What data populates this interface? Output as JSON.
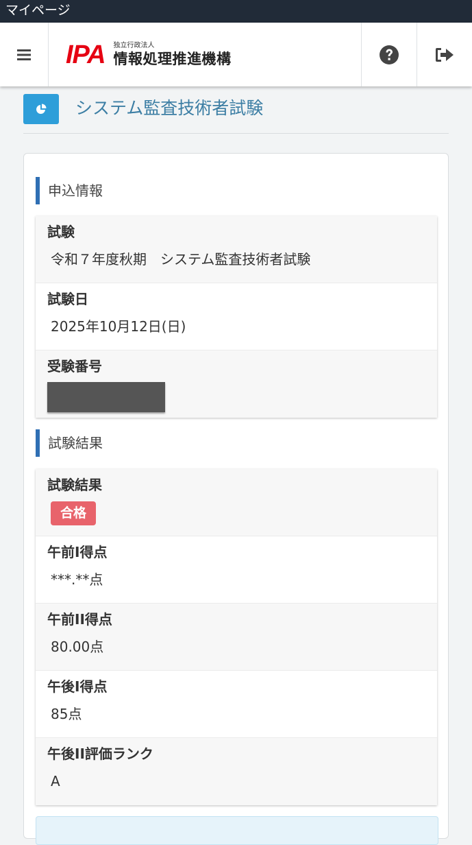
{
  "window": {
    "title": "マイページ"
  },
  "navbar": {
    "logo_text": "IPA",
    "org_sub": "独立行政法人",
    "org_name": "情報処理推進機構",
    "icons": [
      "menu-icon",
      "help-icon",
      "logout-icon"
    ]
  },
  "page": {
    "icon": "pie-chart-icon",
    "title": "システム監査技術者試験"
  },
  "application": {
    "heading": "申込情報",
    "rows": [
      {
        "label": "試験",
        "value": "令和７年度秋期　システム監査技術者試験"
      },
      {
        "label": "試験日",
        "value": "2025年10月12日(日)"
      },
      {
        "label": "受験番号",
        "value": ""
      }
    ]
  },
  "result": {
    "heading": "試験結果",
    "status_label": "試験結果",
    "status_badge": "合格",
    "rows": [
      {
        "label": "午前I得点",
        "value": "***.**点"
      },
      {
        "label": "午前II得点",
        "value": "80.00点"
      },
      {
        "label": "午後I得点",
        "value": "85点"
      },
      {
        "label": "午後II評価ランク",
        "value": "A"
      }
    ]
  },
  "colors": {
    "titlebar": "#212b38",
    "accent_blue": "#2e9ed9",
    "section_bar": "#2f6fb4",
    "title_text": "#3c7ea4",
    "pass_badge": "#e8636b",
    "logo_red": "#e60012"
  }
}
